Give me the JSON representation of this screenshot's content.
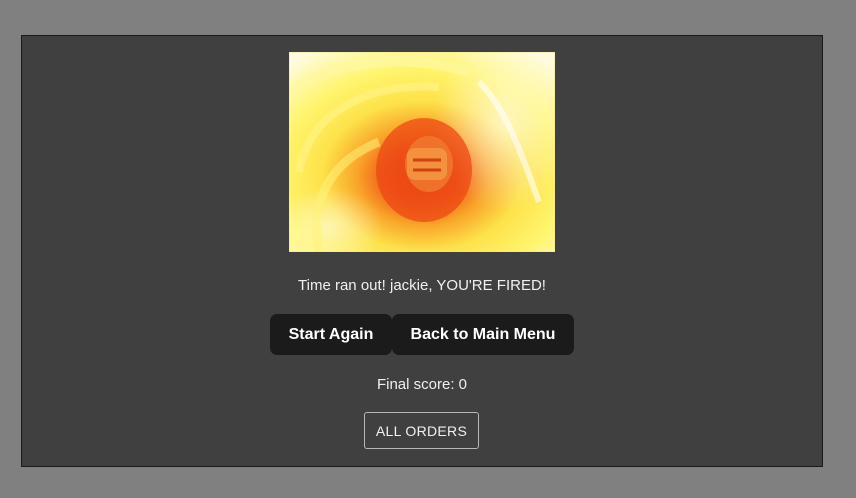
{
  "game_over": {
    "image_icon": "fire-explosion-image",
    "message": "Time ran out! jackie, YOU'RE FIRED!",
    "start_again_label": "Start Again",
    "main_menu_label": "Back to Main Menu",
    "final_score": "Final score: 0",
    "all_orders_label": "ALL ORDERS"
  },
  "colors": {
    "page_background": "#808080",
    "panel_background": "#404040",
    "button_background": "#1b1b1b",
    "text": "#f0f0f0"
  }
}
